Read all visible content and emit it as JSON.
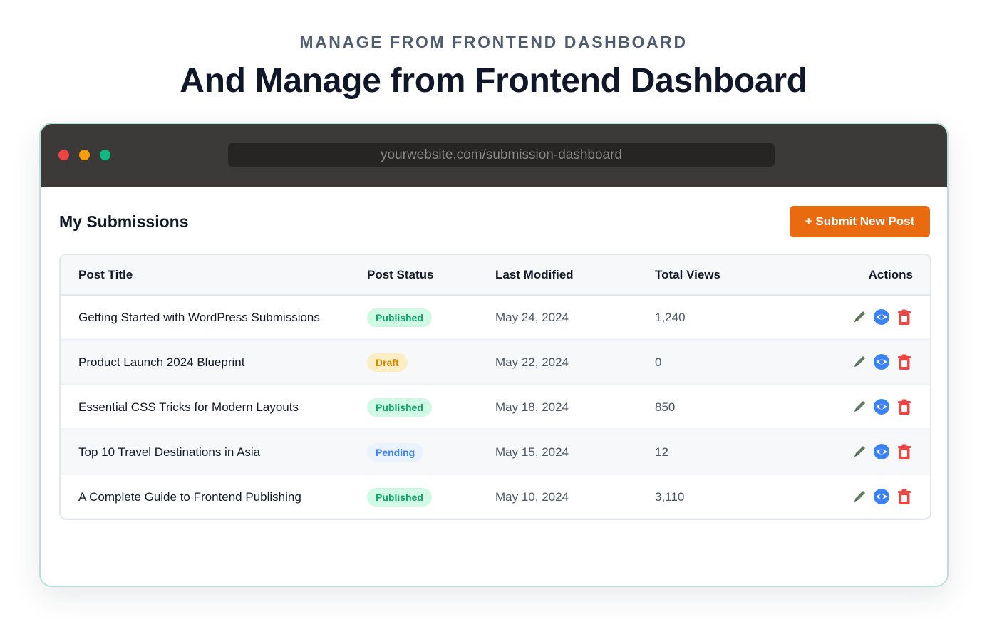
{
  "header": {
    "kicker": "MANAGE FROM FRONTEND DASHBOARD",
    "headline": "And Manage from Frontend Dashboard"
  },
  "browser": {
    "url": "yourwebsite.com/submission-dashboard"
  },
  "dashboard": {
    "title": "My Submissions",
    "submit_label": "+ Submit New Post",
    "columns": {
      "title": "Post Title",
      "status": "Post Status",
      "modified": "Last Modified",
      "views": "Total Views",
      "actions": "Actions"
    },
    "rows": [
      {
        "title": "Getting Started with WordPress Submissions",
        "status": "Published",
        "status_key": "published",
        "modified": "May 24, 2024",
        "views": "1,240"
      },
      {
        "title": "Product Launch 2024 Blueprint",
        "status": "Draft",
        "status_key": "draft",
        "modified": "May 22, 2024",
        "views": "0"
      },
      {
        "title": "Essential CSS Tricks for Modern Layouts",
        "status": "Published",
        "status_key": "published",
        "modified": "May 18, 2024",
        "views": "850"
      },
      {
        "title": "Top 10 Travel Destinations in Asia",
        "status": "Pending",
        "status_key": "pending",
        "modified": "May 15, 2024",
        "views": "12"
      },
      {
        "title": "A Complete Guide to Frontend Publishing",
        "status": "Published",
        "status_key": "published",
        "modified": "May 10, 2024",
        "views": "3,110"
      }
    ],
    "action_icons": [
      "edit-icon",
      "view-icon",
      "delete-icon"
    ]
  },
  "colors": {
    "accent": "#ea6a0f",
    "published": "#10a36b",
    "draft": "#d18c06",
    "pending": "#3b82f6",
    "edit": "#5f7a63",
    "view": "#3b82f6",
    "delete": "#ef4444"
  }
}
